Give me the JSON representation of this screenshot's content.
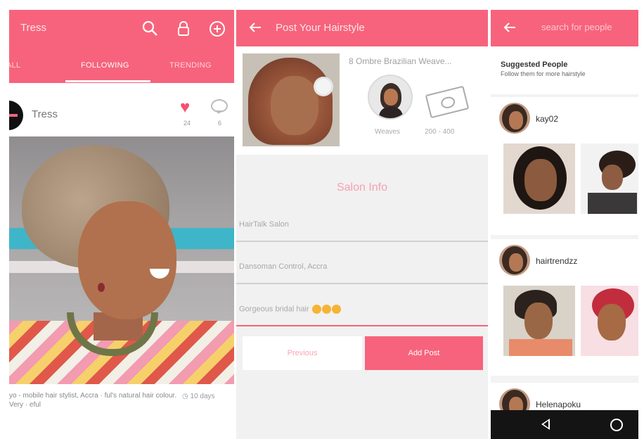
{
  "feed": {
    "app_title": "Tress",
    "tabs": [
      "ALL",
      "FOLLOWING",
      "TRENDING"
    ],
    "post": {
      "username": "Tress",
      "likes": "24",
      "comments": "6",
      "caption": "yo - mobile hair stylist, Accra · ful's natural hair colour. Very · eful",
      "time": "10 days"
    },
    "icons": [
      "search-icon",
      "lock-icon",
      "add-circle-icon",
      "heart-icon",
      "comment-icon",
      "clock-icon"
    ]
  },
  "post_form": {
    "header": "Post Your Hairstyle",
    "style_title": "8 Ombre Brazilian Weave...",
    "category": "Weaves",
    "price_range": "200 - 400",
    "section_title": "Salon Info",
    "fields": {
      "salon_name": "HairTalk Salon",
      "location": "Dansoman Control, Accra",
      "description": "Gorgeous bridal hair"
    },
    "buttons": {
      "previous": "Previous",
      "add_post": "Add Post"
    },
    "colors": {
      "accent": "#f7637c"
    }
  },
  "people": {
    "search_placeholder": "search for people",
    "suggested_title": "Suggested People",
    "suggested_subtitle": "Follow them for more hairstyle",
    "users": [
      {
        "name": "kay02"
      },
      {
        "name": "hairtrendzz"
      },
      {
        "name": "Helenapoku"
      }
    ]
  }
}
